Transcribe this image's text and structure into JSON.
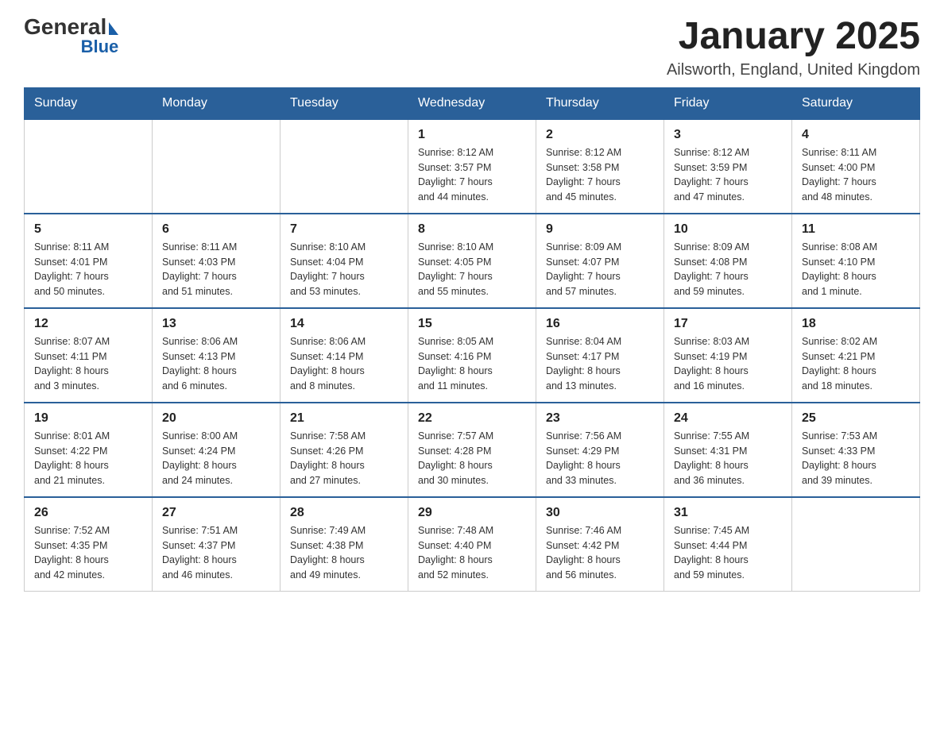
{
  "header": {
    "logo_general": "General",
    "logo_blue": "Blue",
    "title": "January 2025",
    "subtitle": "Ailsworth, England, United Kingdom"
  },
  "days_of_week": [
    "Sunday",
    "Monday",
    "Tuesday",
    "Wednesday",
    "Thursday",
    "Friday",
    "Saturday"
  ],
  "weeks": [
    [
      {
        "day": "",
        "info": ""
      },
      {
        "day": "",
        "info": ""
      },
      {
        "day": "",
        "info": ""
      },
      {
        "day": "1",
        "info": "Sunrise: 8:12 AM\nSunset: 3:57 PM\nDaylight: 7 hours\nand 44 minutes."
      },
      {
        "day": "2",
        "info": "Sunrise: 8:12 AM\nSunset: 3:58 PM\nDaylight: 7 hours\nand 45 minutes."
      },
      {
        "day": "3",
        "info": "Sunrise: 8:12 AM\nSunset: 3:59 PM\nDaylight: 7 hours\nand 47 minutes."
      },
      {
        "day": "4",
        "info": "Sunrise: 8:11 AM\nSunset: 4:00 PM\nDaylight: 7 hours\nand 48 minutes."
      }
    ],
    [
      {
        "day": "5",
        "info": "Sunrise: 8:11 AM\nSunset: 4:01 PM\nDaylight: 7 hours\nand 50 minutes."
      },
      {
        "day": "6",
        "info": "Sunrise: 8:11 AM\nSunset: 4:03 PM\nDaylight: 7 hours\nand 51 minutes."
      },
      {
        "day": "7",
        "info": "Sunrise: 8:10 AM\nSunset: 4:04 PM\nDaylight: 7 hours\nand 53 minutes."
      },
      {
        "day": "8",
        "info": "Sunrise: 8:10 AM\nSunset: 4:05 PM\nDaylight: 7 hours\nand 55 minutes."
      },
      {
        "day": "9",
        "info": "Sunrise: 8:09 AM\nSunset: 4:07 PM\nDaylight: 7 hours\nand 57 minutes."
      },
      {
        "day": "10",
        "info": "Sunrise: 8:09 AM\nSunset: 4:08 PM\nDaylight: 7 hours\nand 59 minutes."
      },
      {
        "day": "11",
        "info": "Sunrise: 8:08 AM\nSunset: 4:10 PM\nDaylight: 8 hours\nand 1 minute."
      }
    ],
    [
      {
        "day": "12",
        "info": "Sunrise: 8:07 AM\nSunset: 4:11 PM\nDaylight: 8 hours\nand 3 minutes."
      },
      {
        "day": "13",
        "info": "Sunrise: 8:06 AM\nSunset: 4:13 PM\nDaylight: 8 hours\nand 6 minutes."
      },
      {
        "day": "14",
        "info": "Sunrise: 8:06 AM\nSunset: 4:14 PM\nDaylight: 8 hours\nand 8 minutes."
      },
      {
        "day": "15",
        "info": "Sunrise: 8:05 AM\nSunset: 4:16 PM\nDaylight: 8 hours\nand 11 minutes."
      },
      {
        "day": "16",
        "info": "Sunrise: 8:04 AM\nSunset: 4:17 PM\nDaylight: 8 hours\nand 13 minutes."
      },
      {
        "day": "17",
        "info": "Sunrise: 8:03 AM\nSunset: 4:19 PM\nDaylight: 8 hours\nand 16 minutes."
      },
      {
        "day": "18",
        "info": "Sunrise: 8:02 AM\nSunset: 4:21 PM\nDaylight: 8 hours\nand 18 minutes."
      }
    ],
    [
      {
        "day": "19",
        "info": "Sunrise: 8:01 AM\nSunset: 4:22 PM\nDaylight: 8 hours\nand 21 minutes."
      },
      {
        "day": "20",
        "info": "Sunrise: 8:00 AM\nSunset: 4:24 PM\nDaylight: 8 hours\nand 24 minutes."
      },
      {
        "day": "21",
        "info": "Sunrise: 7:58 AM\nSunset: 4:26 PM\nDaylight: 8 hours\nand 27 minutes."
      },
      {
        "day": "22",
        "info": "Sunrise: 7:57 AM\nSunset: 4:28 PM\nDaylight: 8 hours\nand 30 minutes."
      },
      {
        "day": "23",
        "info": "Sunrise: 7:56 AM\nSunset: 4:29 PM\nDaylight: 8 hours\nand 33 minutes."
      },
      {
        "day": "24",
        "info": "Sunrise: 7:55 AM\nSunset: 4:31 PM\nDaylight: 8 hours\nand 36 minutes."
      },
      {
        "day": "25",
        "info": "Sunrise: 7:53 AM\nSunset: 4:33 PM\nDaylight: 8 hours\nand 39 minutes."
      }
    ],
    [
      {
        "day": "26",
        "info": "Sunrise: 7:52 AM\nSunset: 4:35 PM\nDaylight: 8 hours\nand 42 minutes."
      },
      {
        "day": "27",
        "info": "Sunrise: 7:51 AM\nSunset: 4:37 PM\nDaylight: 8 hours\nand 46 minutes."
      },
      {
        "day": "28",
        "info": "Sunrise: 7:49 AM\nSunset: 4:38 PM\nDaylight: 8 hours\nand 49 minutes."
      },
      {
        "day": "29",
        "info": "Sunrise: 7:48 AM\nSunset: 4:40 PM\nDaylight: 8 hours\nand 52 minutes."
      },
      {
        "day": "30",
        "info": "Sunrise: 7:46 AM\nSunset: 4:42 PM\nDaylight: 8 hours\nand 56 minutes."
      },
      {
        "day": "31",
        "info": "Sunrise: 7:45 AM\nSunset: 4:44 PM\nDaylight: 8 hours\nand 59 minutes."
      },
      {
        "day": "",
        "info": ""
      }
    ]
  ]
}
